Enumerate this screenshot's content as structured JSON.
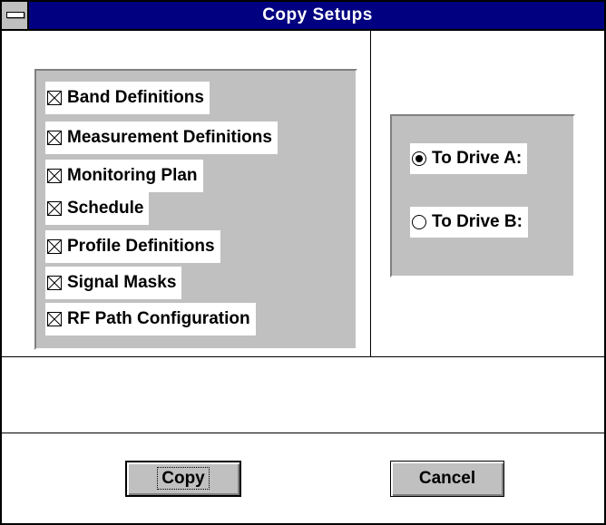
{
  "window": {
    "title": "Copy Setups"
  },
  "items": [
    {
      "label": "Band Definitions",
      "checked": true
    },
    {
      "label": "Measurement Definitions",
      "checked": true
    },
    {
      "label": "Monitoring Plan",
      "checked": true
    },
    {
      "label": "Schedule",
      "checked": true
    },
    {
      "label": "Profile Definitions",
      "checked": true
    },
    {
      "label": "Signal Masks",
      "checked": true
    },
    {
      "label": "RF Path Configuration",
      "checked": true
    }
  ],
  "destination": {
    "options": [
      {
        "label": "To Drive A:",
        "selected": true
      },
      {
        "label": "To Drive B:",
        "selected": false
      }
    ]
  },
  "buttons": {
    "copy": "Copy",
    "cancel": "Cancel"
  },
  "colors": {
    "titlebar": "#000080",
    "face": "#c0c0c0",
    "shadow": "#808080"
  }
}
